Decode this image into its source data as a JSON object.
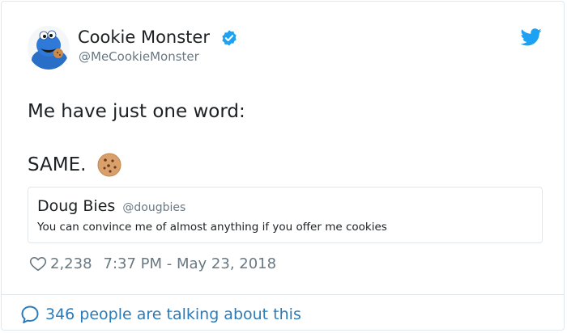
{
  "author": {
    "name": "Cookie Monster",
    "handle": "@MeCookieMonster",
    "avatar_icon": "cookie-monster-avatar",
    "verified_icon": "verified-badge-icon"
  },
  "tweet": {
    "line1": "Me have just one word:",
    "line2": "SAME.",
    "emoji": "cookie-emoji"
  },
  "quoted_tweet": {
    "name": "Doug Bies",
    "handle": "@dougbies",
    "text": "You can convince me of almost anything if you offer me cookies"
  },
  "meta": {
    "likes": "2,238",
    "timestamp": "7:37 PM - May 23, 2018"
  },
  "footer": {
    "conversation_label": "346 people are talking about this"
  },
  "colors": {
    "accent": "#1da1f2",
    "link": "#2b7bb9",
    "secondary_text": "#697882",
    "border": "#e1e8ed"
  }
}
